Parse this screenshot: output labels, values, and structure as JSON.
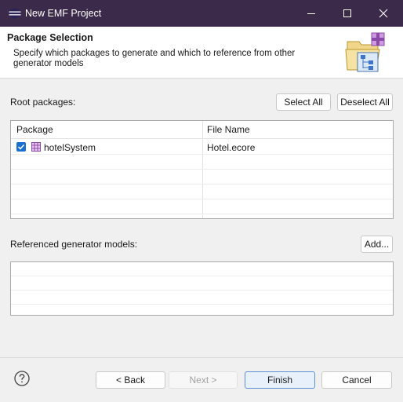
{
  "window": {
    "title": "New EMF Project"
  },
  "header": {
    "title": "Package Selection",
    "description": "Specify which packages to generate and which to reference from other generator models"
  },
  "root_packages": {
    "label": "Root packages:",
    "select_all": "Select All",
    "deselect_all": "Deselect All",
    "columns": [
      "Package",
      "File Name"
    ],
    "rows": [
      {
        "package": "hotelSystem",
        "file": "Hotel.ecore",
        "checked": true
      }
    ]
  },
  "referenced": {
    "label": "Referenced generator models:",
    "add": "Add..."
  },
  "footer": {
    "back": "< Back",
    "next": "Next >",
    "finish": "Finish",
    "cancel": "Cancel"
  },
  "colors": {
    "titlebar": "#3c2a4a",
    "checkbox": "#1a6fd0",
    "default_button_border": "#5b8fd6"
  },
  "icons": [
    "eclipse-app-icon",
    "minimize-icon",
    "maximize-icon",
    "close-icon",
    "package-wizard-icon",
    "checkbox-checked-icon",
    "package-icon",
    "help-icon"
  ]
}
